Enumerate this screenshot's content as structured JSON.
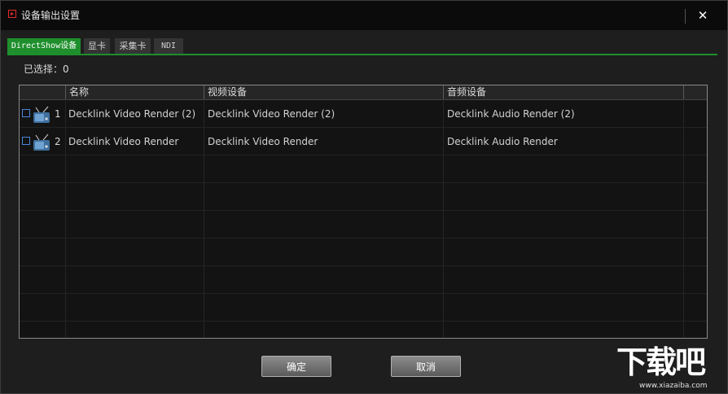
{
  "window": {
    "title": "设备输出设置",
    "close_label": "✕"
  },
  "tabs": [
    {
      "label": "DirectShow设备",
      "active": true
    },
    {
      "label": "显卡",
      "active": false
    },
    {
      "label": "采集卡",
      "active": false
    },
    {
      "label": "NDI",
      "active": false
    }
  ],
  "selection": {
    "label": "已选择：0"
  },
  "table": {
    "columns": [
      "名称",
      "视频设备",
      "音频设备"
    ],
    "rows": [
      {
        "index": "1",
        "name": "Decklink Video Render (2)",
        "video": "Decklink Video Render (2)",
        "audio": "Decklink Audio Render (2)",
        "checked": false
      },
      {
        "index": "2",
        "name": "Decklink Video Render",
        "video": "Decklink Video Render",
        "audio": "Decklink Audio Render",
        "checked": false
      }
    ]
  },
  "buttons": {
    "ok": "确定",
    "cancel": "取消"
  },
  "watermark": {
    "logo_text": "下载吧",
    "url": "www.xiazaiba.com"
  },
  "colors": {
    "accent": "#1e8f2c",
    "title_icon": "#e02a2a",
    "checkbox": "#4a86d8"
  },
  "icons": {
    "app": "app-play-icon",
    "row": "tv-device-icon",
    "close": "close-icon"
  }
}
